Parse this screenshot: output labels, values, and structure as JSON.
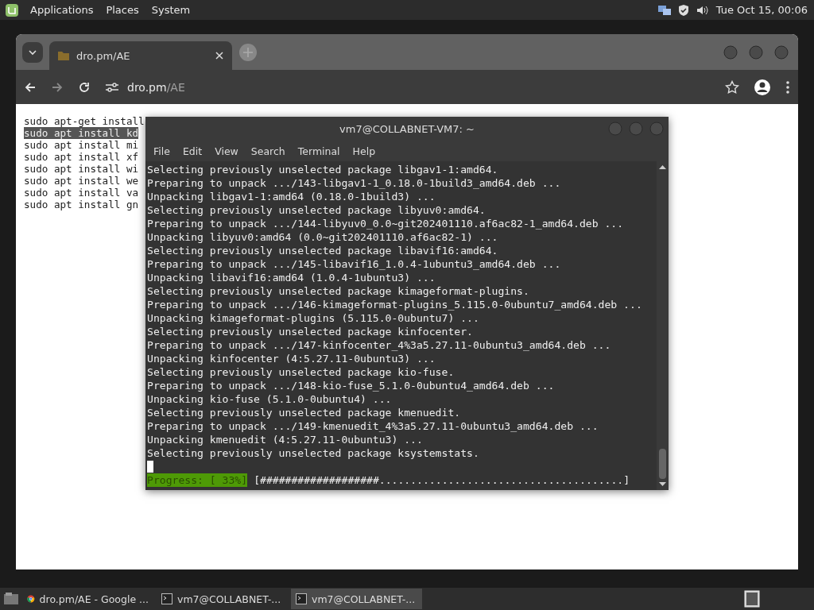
{
  "top_panel": {
    "menu": [
      "Applications",
      "Places",
      "System"
    ],
    "clock": "Tue Oct 15, 00:06"
  },
  "browser": {
    "tabs": [
      {
        "title": "dro.pm/AE",
        "selected": true
      }
    ],
    "address": {
      "host": "dro.pm",
      "path": "/AE"
    },
    "page_lines": [
      {
        "text": "sudo apt-get install",
        "selected": false
      },
      {
        "text": "sudo apt install kd",
        "selected": true
      },
      {
        "text": "sudo apt install mi",
        "selected": false
      },
      {
        "text": "sudo apt install xf",
        "selected": false
      },
      {
        "text": "sudo apt install wi",
        "selected": false
      },
      {
        "text": "sudo apt install we",
        "selected": false
      },
      {
        "text": "sudo apt install va",
        "selected": false
      },
      {
        "text": "sudo apt install gn",
        "selected": false
      }
    ]
  },
  "terminal": {
    "title": "vm7@COLLABNET-VM7: ~",
    "menu": [
      "File",
      "Edit",
      "View",
      "Search",
      "Terminal",
      "Help"
    ],
    "lines": [
      "Selecting previously unselected package libgav1-1:amd64.",
      "Preparing to unpack .../143-libgav1-1_0.18.0-1build3_amd64.deb ...",
      "Unpacking libgav1-1:amd64 (0.18.0-1build3) ...",
      "Selecting previously unselected package libyuv0:amd64.",
      "Preparing to unpack .../144-libyuv0_0.0~git202401110.af6ac82-1_amd64.deb ...",
      "Unpacking libyuv0:amd64 (0.0~git202401110.af6ac82-1) ...",
      "Selecting previously unselected package libavif16:amd64.",
      "Preparing to unpack .../145-libavif16_1.0.4-1ubuntu3_amd64.deb ...",
      "Unpacking libavif16:amd64 (1.0.4-1ubuntu3) ...",
      "Selecting previously unselected package kimageformat-plugins.",
      "Preparing to unpack .../146-kimageformat-plugins_5.115.0-0ubuntu7_amd64.deb ...",
      "Unpacking kimageformat-plugins (5.115.0-0ubuntu7) ...",
      "Selecting previously unselected package kinfocenter.",
      "Preparing to unpack .../147-kinfocenter_4%3a5.27.11-0ubuntu3_amd64.deb ...",
      "Unpacking kinfocenter (4:5.27.11-0ubuntu3) ...",
      "Selecting previously unselected package kio-fuse.",
      "Preparing to unpack .../148-kio-fuse_5.1.0-0ubuntu4_amd64.deb ...",
      "Unpacking kio-fuse (5.1.0-0ubuntu4) ...",
      "Selecting previously unselected package kmenuedit.",
      "Preparing to unpack .../149-kmenuedit_4%3a5.27.11-0ubuntu3_amd64.deb ...",
      "Unpacking kmenuedit (4:5.27.11-0ubuntu3) ...",
      "Selecting previously unselected package ksystemstats."
    ],
    "progress": {
      "label": "Progress: [ 33%]",
      "bar": "[###################.......................................]"
    }
  },
  "taskbar": {
    "items": [
      {
        "kind": "browser",
        "label": "dro.pm/AE - Google ...",
        "selected": false
      },
      {
        "kind": "terminal",
        "label": "vm7@COLLABNET-...",
        "selected": false
      },
      {
        "kind": "terminal",
        "label": "vm7@COLLABNET-...",
        "selected": true
      }
    ]
  }
}
